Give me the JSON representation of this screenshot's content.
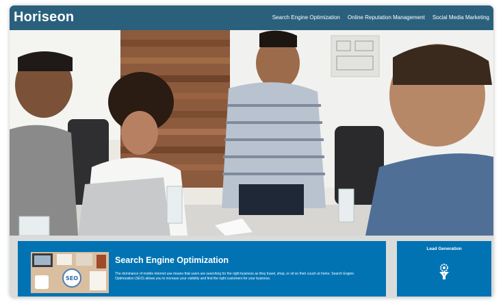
{
  "header": {
    "logo": "Horiseon",
    "nav": [
      {
        "label": "Search Engine Optimization"
      },
      {
        "label": "Online Reputation Management"
      },
      {
        "label": "Social Media Marketing"
      }
    ]
  },
  "hero": {
    "image": "team-meeting-photo"
  },
  "seo": {
    "title": "Search Engine Optimization",
    "text": "The dominance of mobile internet use means that users are searching for the right business as they travel, shop, or sit on their couch at home. Search Engine Optimization (SEO) allows you to increase your visibility and find the right customers for your business.",
    "image_badge": "SEO"
  },
  "lead": {
    "title": "Lead Generation",
    "icon": "lead-funnel-icon"
  },
  "colors": {
    "header": "#2a607c",
    "card": "#0173b3",
    "page": "#d9dcdb"
  }
}
